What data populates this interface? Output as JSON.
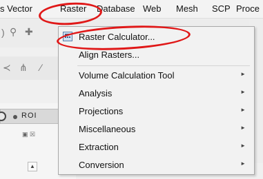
{
  "menubar": {
    "items": [
      {
        "id": "vector",
        "label": "s Vector"
      },
      {
        "id": "raster",
        "label": "Raster"
      },
      {
        "id": "database",
        "label": "Database"
      },
      {
        "id": "web",
        "label": "Web"
      },
      {
        "id": "mesh",
        "label": "Mesh"
      },
      {
        "id": "scp",
        "label": "SCP"
      },
      {
        "id": "processing",
        "label": "Proce"
      }
    ]
  },
  "raster_menu": {
    "items": [
      {
        "label": "Raster Calculator...",
        "icon": "raster-calculator-icon",
        "submenu": false
      },
      {
        "label": "Align Rasters...",
        "submenu": false
      },
      {
        "label": "Volume Calculation Tool",
        "submenu": true
      },
      {
        "label": "Analysis",
        "submenu": true
      },
      {
        "label": "Projections",
        "submenu": true
      },
      {
        "label": "Miscellaneous",
        "submenu": true
      },
      {
        "label": "Extraction",
        "submenu": true
      },
      {
        "label": "Conversion",
        "submenu": true
      }
    ]
  },
  "left_panel": {
    "roi_tab_label": "ROI"
  },
  "colors": {
    "highlight_ellipse": "#e01818",
    "menu_background": "#f2f2f2"
  }
}
